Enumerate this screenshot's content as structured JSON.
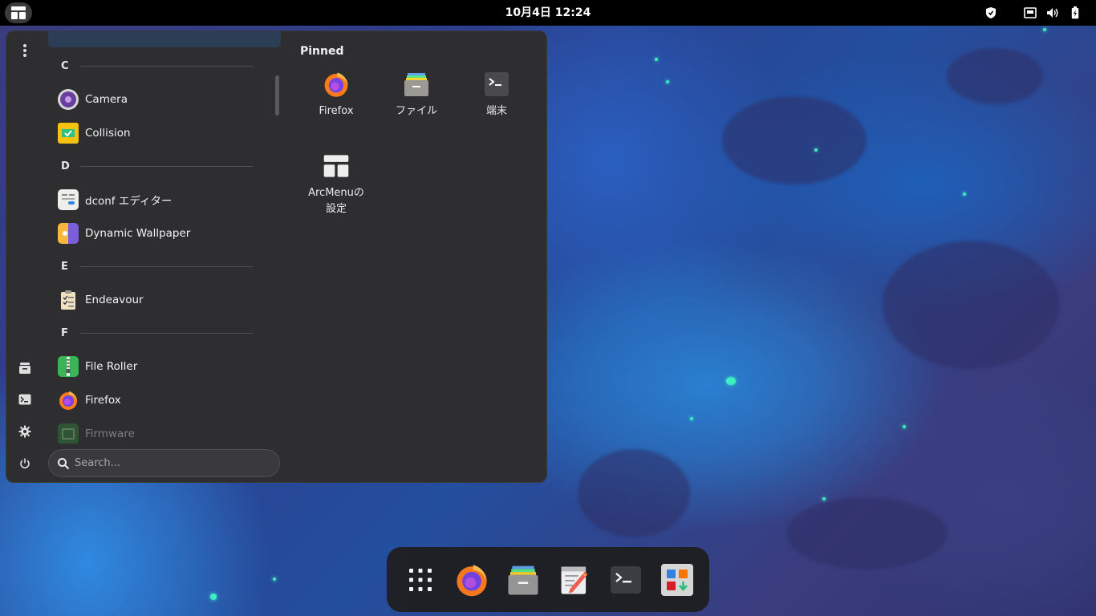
{
  "topbar": {
    "clock": "10月4日  12:24",
    "tray_icons": [
      "shield-icon",
      "network-icon",
      "volume-icon",
      "battery-icon"
    ]
  },
  "menu": {
    "sections": [
      {
        "letter": "C",
        "apps": [
          "Camera",
          "Collision"
        ]
      },
      {
        "letter": "D",
        "apps": [
          "dconf エディター",
          "Dynamic Wallpaper"
        ]
      },
      {
        "letter": "E",
        "apps": [
          "Endeavour"
        ]
      },
      {
        "letter": "F",
        "apps": [
          "File Roller",
          "Firefox",
          "Firmware"
        ]
      }
    ],
    "search_placeholder": "Search...",
    "pinned": {
      "title": "Pinned",
      "items": [
        {
          "label": "Firefox",
          "icon": "firefox-icon"
        },
        {
          "label": "ファイル",
          "icon": "files-icon"
        },
        {
          "label": "端末",
          "icon": "terminal-icon"
        },
        {
          "label_line1": "ArcMenuの",
          "label_line2": "設定",
          "icon": "arcmenu-icon"
        }
      ]
    },
    "sidebar_icons": [
      "more-options-icon",
      "files-icon",
      "terminal-icon",
      "settings-icon",
      "power-icon"
    ]
  },
  "dock": {
    "items": [
      "app-grid-icon",
      "firefox-icon",
      "files-icon",
      "text-editor-icon",
      "terminal-icon",
      "software-icon"
    ]
  },
  "colors": {
    "panel_bg": "#2e2e31",
    "topbar_bg": "#000000",
    "dock_bg": "#1f1f22",
    "accent_sparkle": "#3cf0c0"
  }
}
